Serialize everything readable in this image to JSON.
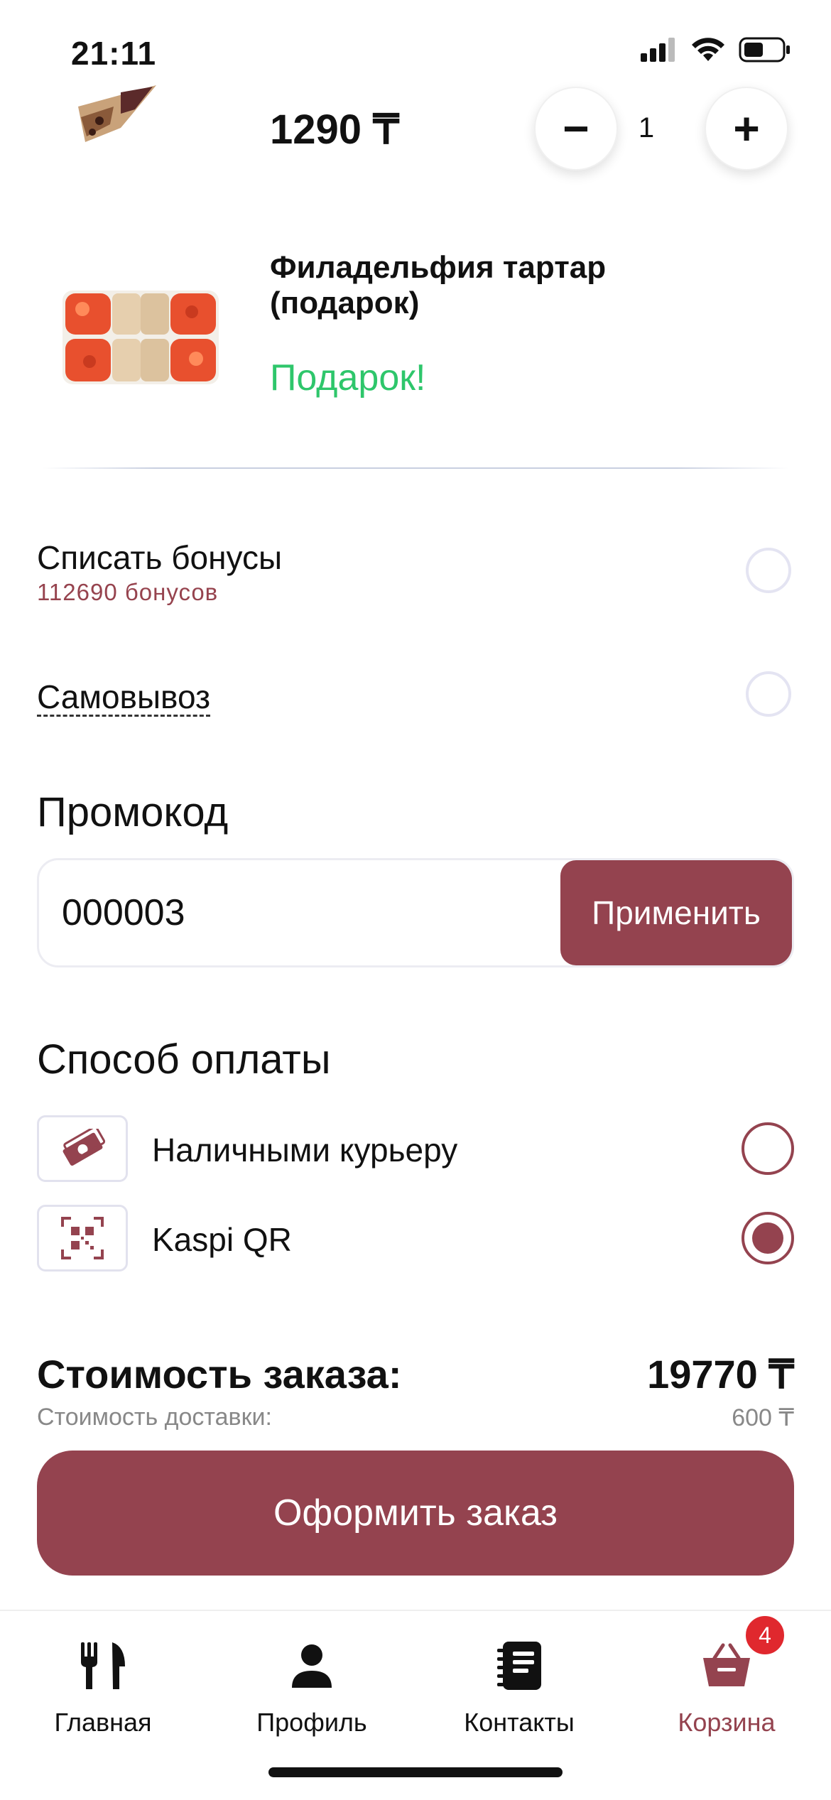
{
  "status_bar": {
    "time": "21:11"
  },
  "cart_items": [
    {
      "price": "1290 ₸",
      "quantity": "1",
      "minus_label": "−",
      "plus_label": "+"
    },
    {
      "name": "Филадельфия тартар (подарок)",
      "gift_label": "Подарок!"
    }
  ],
  "options": {
    "bonus_title": "Списать бонусы",
    "bonus_sub": "112690 бонусов",
    "pickup_title": "Самовывоз"
  },
  "promo": {
    "title": "Промокод",
    "value": "000003",
    "apply_label": "Применить"
  },
  "payment": {
    "title": "Способ оплаты",
    "methods": [
      {
        "label": "Наличными курьеру",
        "selected": false
      },
      {
        "label": "Kaspi QR",
        "selected": true
      }
    ]
  },
  "totals": {
    "order_label": "Стоимость заказа:",
    "order_value": "19770 ₸",
    "delivery_label": "Стоимость доставки:",
    "delivery_value": "600 ₸"
  },
  "checkout_label": "Оформить заказ",
  "tabs": [
    {
      "label": "Главная",
      "icon": "fork-knife-icon"
    },
    {
      "label": "Профиль",
      "icon": "person-icon"
    },
    {
      "label": "Контакты",
      "icon": "notebook-icon"
    },
    {
      "label": "Корзина",
      "icon": "basket-icon",
      "badge": "4",
      "active": true
    }
  ],
  "colors": {
    "accent": "#94434f",
    "gift_green": "#2ec66b",
    "badge_red": "#e0282e"
  }
}
